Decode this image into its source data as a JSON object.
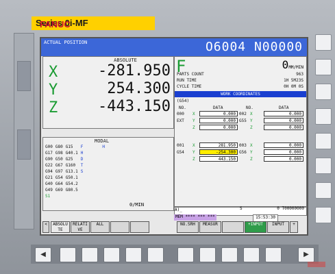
{
  "brand": {
    "fanuc": "FANUC",
    "series": "Series 0i-MF"
  },
  "header": {
    "title": "ACTUAL POSITION",
    "program": "O6004 N00000"
  },
  "position": {
    "header": "ABSOLUTE",
    "axes": [
      {
        "axis": "X",
        "value": "-281.950"
      },
      {
        "axis": "Y",
        "value": "254.300"
      },
      {
        "axis": "Z",
        "value": "-443.150"
      }
    ]
  },
  "feed": {
    "label": "F",
    "value": "0",
    "unit": "MM/MIN"
  },
  "info": [
    {
      "label": "PARTS COUNT",
      "value": "963"
    },
    {
      "label": "RUN TIME",
      "value": "1H 5M23S"
    },
    {
      "label": "CYCLE TIME",
      "value": "0H 0M 0S"
    }
  ],
  "work_coords": {
    "header": "WORK COORDINATES",
    "system": "(G54)",
    "col_no": "NO.",
    "col_data": "DATA",
    "rows": [
      {
        "no": "000",
        "label": "EXT",
        "axis": "X",
        "data": "0.000",
        "no2": "002",
        "axis2": "X",
        "data2": "0.000"
      },
      {
        "no": "",
        "label": "",
        "axis": "Y",
        "data": "0.000",
        "no2": "G55",
        "axis2": "Y",
        "data2": "0.000"
      },
      {
        "no": "",
        "label": "",
        "axis": "Z",
        "data": "0.000",
        "no2": "",
        "axis2": "Z",
        "data2": "0.000"
      },
      {
        "no": "001",
        "label": "",
        "axis": "X",
        "data": "281.950",
        "no2": "003",
        "axis2": "X",
        "data2": "0.000"
      },
      {
        "no": "G54",
        "label": "",
        "axis": "Y",
        "data": "-254.300",
        "no2": "G56",
        "axis2": "Y",
        "data2": "0.000"
      },
      {
        "no": "",
        "label": "",
        "axis": "Z",
        "data": "443.150",
        "no2": "",
        "axis2": "Z",
        "data2": "0.000"
      }
    ]
  },
  "modal": {
    "header": "MODAL",
    "rows": [
      [
        "G00",
        "G80",
        "G15",
        "F",
        "",
        "H"
      ],
      [
        "G17",
        "G98",
        "G40.1",
        "H",
        ""
      ],
      [
        "G90",
        "G50",
        "G25",
        "D",
        ""
      ],
      [
        "G22",
        "G67",
        "G160",
        "T",
        ""
      ],
      [
        "G94",
        "G97",
        "G13.1",
        "S",
        ""
      ],
      [
        "G21",
        "G54",
        "G50.1",
        ""
      ],
      [
        "G40",
        "G64",
        "G54.2",
        ""
      ],
      [
        "G49",
        "G69",
        "G80.5",
        ""
      ]
    ],
    "s_label": "S1",
    "feed_unit": "0/MIN"
  },
  "input_line": "A)_",
  "status": {
    "s_label": "S",
    "s_value": "0 T00000000",
    "mem": "MEM **** *** ***",
    "clock": "15:53:30"
  },
  "softkeys": [
    {
      "label": "<",
      "id": "prev"
    },
    {
      "label": "ABSOLU TE",
      "id": "absolute"
    },
    {
      "label": "RELATI VE",
      "id": "relative"
    },
    {
      "label": "ALL",
      "id": "all"
    },
    {
      "label": "",
      "id": "blank1"
    },
    {
      "label": "",
      "id": "blank2"
    },
    {
      "label": "NO.SRH",
      "id": "nosrh"
    },
    {
      "label": "MEASUR",
      "id": "measur"
    },
    {
      "label": "",
      "id": "blank3"
    },
    {
      "label": "+INPUT",
      "id": "plus_input"
    },
    {
      "label": "INPUT",
      "id": "input"
    },
    {
      "label": "+",
      "id": "next"
    }
  ],
  "nav": {
    "left_arrow": "◀",
    "right_arrow": "▶"
  }
}
